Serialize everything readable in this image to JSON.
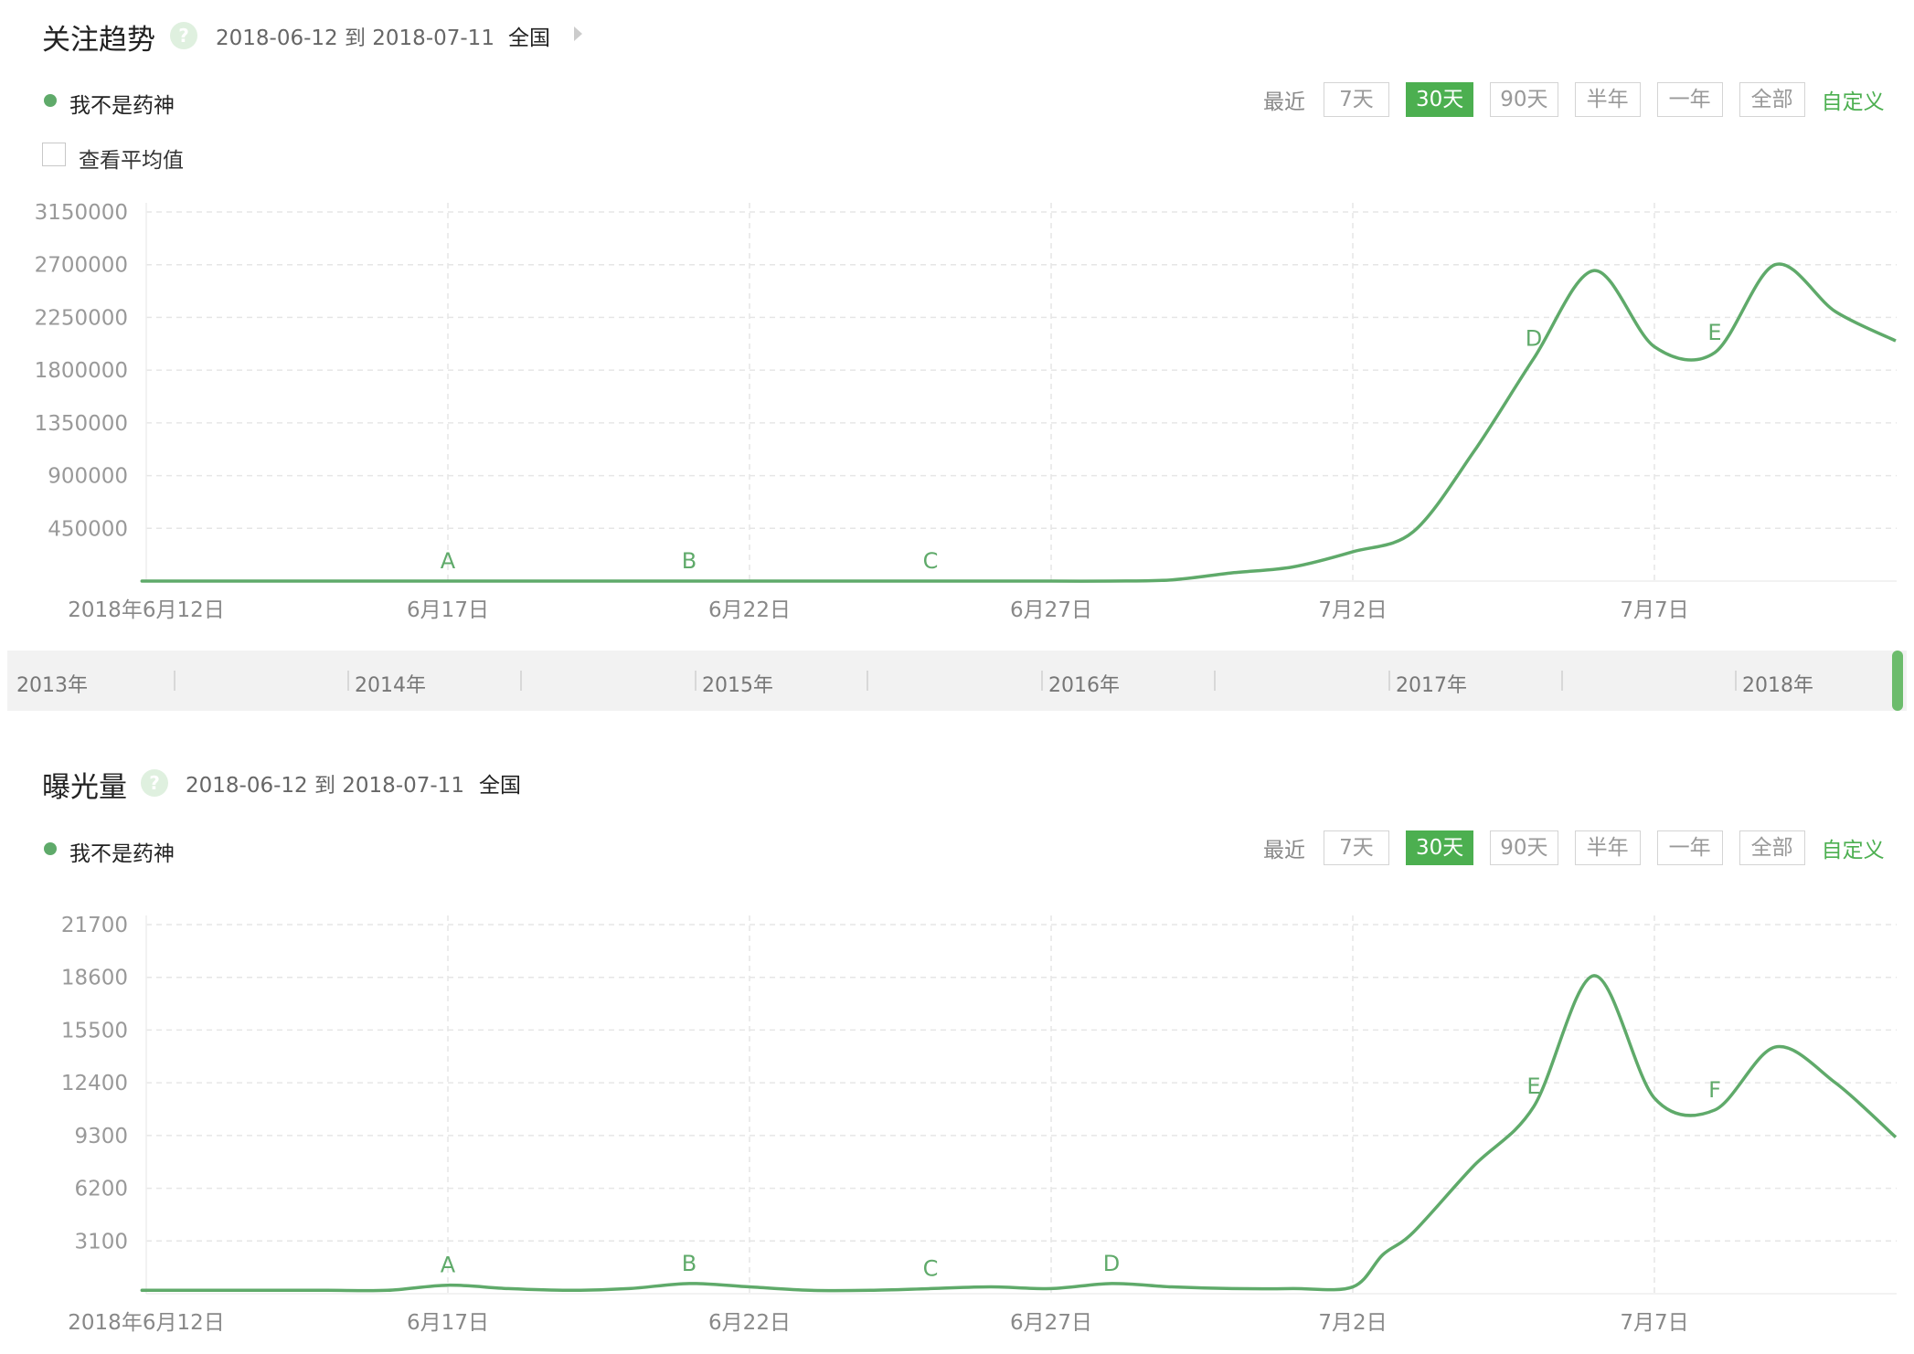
{
  "panels": [
    {
      "title": "关注趋势",
      "help": "?",
      "date_range": "2018-06-12 到 2018-07-11",
      "region": "全国",
      "legend": "我不是药神",
      "avg_checkbox_label": "查看平均值",
      "range": {
        "label": "最近",
        "buttons": [
          "7天",
          "30天",
          "90天",
          "半年",
          "一年",
          "全部"
        ],
        "active": "30天",
        "custom": "自定义"
      }
    },
    {
      "title": "曝光量",
      "help": "?",
      "date_range": "2018-06-12 到 2018-07-11",
      "region": "全国",
      "legend": "我不是药神",
      "range": {
        "label": "最近",
        "buttons": [
          "7天",
          "30天",
          "90天",
          "半年",
          "一年",
          "全部"
        ],
        "active": "30天",
        "custom": "自定义"
      }
    }
  ],
  "timeline": {
    "years": [
      "2013年",
      "2014年",
      "2015年",
      "2016年",
      "2017年",
      "2018年"
    ]
  },
  "colors": {
    "line": "#5faa6a",
    "accent": "#4caf50",
    "grid": "#e6e6e6"
  },
  "chart_data": [
    {
      "type": "line",
      "series": [
        {
          "name": "我不是药神",
          "values": [
            0,
            0,
            0,
            0,
            0,
            0,
            0,
            0,
            0,
            0,
            0,
            0,
            0,
            0,
            0,
            0,
            0,
            0,
            10000,
            70000,
            120000,
            250000,
            420000,
            1100000,
            1900000,
            2650000,
            2000000,
            1950000,
            2700000,
            2300000,
            2050000
          ]
        }
      ],
      "x": [
        "2018-06-11",
        "2018-06-12",
        "2018-06-13",
        "2018-06-14",
        "2018-06-15",
        "2018-06-16",
        "2018-06-17",
        "2018-06-18",
        "2018-06-19",
        "2018-06-20",
        "2018-06-21",
        "2018-06-22",
        "2018-06-23",
        "2018-06-24",
        "2018-06-25",
        "2018-06-26",
        "2018-06-27",
        "2018-06-28",
        "2018-06-29",
        "2018-06-30",
        "2018-07-01",
        "2018-07-02",
        "2018-07-03",
        "2018-07-04",
        "2018-07-05",
        "2018-07-06",
        "2018-07-07",
        "2018-07-08",
        "2018-07-09",
        "2018-07-10",
        "2018-07-11"
      ],
      "xticks": [
        {
          "label": "2018年6月12日",
          "x": "2018-06-12"
        },
        {
          "label": "6月17日",
          "x": "2018-06-17"
        },
        {
          "label": "6月22日",
          "x": "2018-06-22"
        },
        {
          "label": "6月27日",
          "x": "2018-06-27"
        },
        {
          "label": "7月2日",
          "x": "2018-07-02"
        },
        {
          "label": "7月7日",
          "x": "2018-07-07"
        }
      ],
      "yticks": [
        450000,
        900000,
        1350000,
        1800000,
        2250000,
        2700000,
        3150000
      ],
      "ylim": [
        0,
        3150000
      ],
      "annotations": [
        {
          "label": "A",
          "x": "2018-06-17"
        },
        {
          "label": "B",
          "x": "2018-06-21"
        },
        {
          "label": "C",
          "x": "2018-06-25"
        },
        {
          "label": "D",
          "x": "2018-07-05"
        },
        {
          "label": "E",
          "x": "2018-07-08"
        }
      ]
    },
    {
      "type": "line",
      "series": [
        {
          "name": "我不是药神",
          "values": [
            200,
            200,
            200,
            200,
            200,
            200,
            500,
            300,
            200,
            300,
            600,
            400,
            200,
            200,
            300,
            400,
            300,
            600,
            400,
            300,
            300,
            400,
            2300,
            3600,
            7500,
            11000,
            18700,
            11500,
            10800,
            14500,
            12400,
            9200
          ]
        }
      ],
      "x": [
        "2018-06-11",
        "2018-06-12",
        "2018-06-13",
        "2018-06-14",
        "2018-06-15",
        "2018-06-16",
        "2018-06-17",
        "2018-06-18",
        "2018-06-19",
        "2018-06-20",
        "2018-06-21",
        "2018-06-22",
        "2018-06-23",
        "2018-06-24",
        "2018-06-25",
        "2018-06-26",
        "2018-06-27",
        "2018-06-28",
        "2018-06-29",
        "2018-06-30",
        "2018-07-01",
        "2018-07-02",
        "2018-07-02b",
        "2018-07-03",
        "2018-07-04",
        "2018-07-05",
        "2018-07-06",
        "2018-07-07",
        "2018-07-08",
        "2018-07-09",
        "2018-07-10",
        "2018-07-11"
      ],
      "xticks": [
        {
          "label": "2018年6月12日",
          "x": "2018-06-12"
        },
        {
          "label": "6月17日",
          "x": "2018-06-17"
        },
        {
          "label": "6月22日",
          "x": "2018-06-22"
        },
        {
          "label": "6月27日",
          "x": "2018-06-27"
        },
        {
          "label": "7月2日",
          "x": "2018-07-02"
        },
        {
          "label": "7月7日",
          "x": "2018-07-07"
        }
      ],
      "yticks": [
        3100,
        6200,
        9300,
        12400,
        15500,
        18600,
        21700
      ],
      "ylim": [
        0,
        21700
      ],
      "annotations": [
        {
          "label": "A",
          "x": "2018-06-17"
        },
        {
          "label": "B",
          "x": "2018-06-21"
        },
        {
          "label": "C",
          "x": "2018-06-25"
        },
        {
          "label": "D",
          "x": "2018-06-28"
        },
        {
          "label": "E",
          "x": "2018-07-05"
        },
        {
          "label": "F",
          "x": "2018-07-08"
        }
      ]
    }
  ]
}
